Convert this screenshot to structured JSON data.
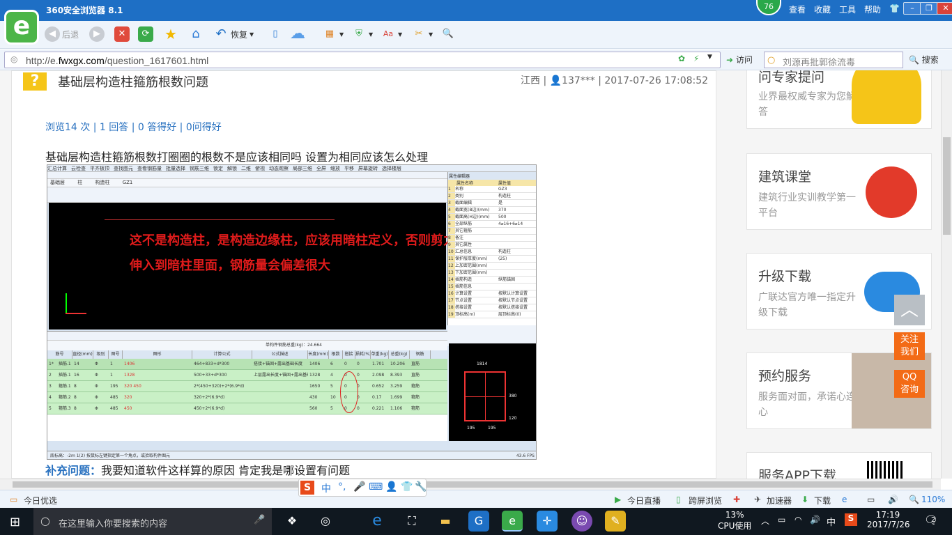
{
  "window": {
    "title": "360安全浏览器 8.1",
    "badge": "76",
    "menu": [
      "查看",
      "收藏",
      "工具",
      "帮助"
    ]
  },
  "toolbar": {
    "back": "后退",
    "restore": "恢复"
  },
  "address": {
    "url_prefix": "http://e.",
    "url_domain": "fwxgx.com",
    "url_path": "/question_1617601.html",
    "visit": "访问",
    "search_placeholder": "刘源再批郭徐流毒",
    "search_btn": "搜索"
  },
  "question": {
    "title": "基础层构造柱箍筋根数问题",
    "meta": "江西 | 👤137*** | 2017-07-26 17:08:52",
    "stats": "浏览14 次 | 1 回答 | 0 答得好 | 0问得好",
    "desc": "基础层构造柱箍筋根数打圈圈的根数不是应该相同吗  设置为相同应该怎么处理",
    "supp_label": "补充问题：",
    "supp_text": "我要知道软件这样算的原因 肯定我是哪设置有问题"
  },
  "annotation": {
    "line1": "这不是构造柱，是构造边缘柱，应该用暗柱定义，否则剪力墙水平钢筋不能",
    "line2": "伸入到暗柱里面，钢筋量会偏差很大"
  },
  "software": {
    "menu": [
      "汇总计算",
      "云检查",
      "平齐板顶",
      "查找图元",
      "查看钢筋量",
      "批量选择",
      "钢筋三维",
      "锁定",
      "解锁",
      "二维",
      "俯视",
      "动态观察",
      "局部三维",
      "全屏",
      "缩放",
      "平移",
      "屏幕旋转",
      "选择楼层"
    ],
    "layer_sel": "基础层",
    "type_sel": "柱",
    "sub_sel": "构造柱",
    "id_sel": "GZ1",
    "prop_title": "属性编辑器",
    "prop_head": [
      "属性名称",
      "属性值"
    ],
    "props": [
      [
        "1",
        "名称",
        "GZ3"
      ],
      [
        "2",
        "类别",
        "构造柱"
      ],
      [
        "3",
        "截面编辑",
        "是"
      ],
      [
        "4",
        "截面宽(B边)(mm)",
        "370"
      ],
      [
        "5",
        "截面高(H边)(mm)",
        "500"
      ],
      [
        "6",
        "全部纵筋",
        "4⌀16+6⌀14"
      ],
      [
        "7",
        "其它箍筋",
        ""
      ],
      [
        "8",
        "备注",
        ""
      ],
      [
        "9",
        "其它属性",
        ""
      ],
      [
        "10",
        "汇总信息",
        "构造柱"
      ],
      [
        "11",
        "保护层厚度(mm)",
        "(25)"
      ],
      [
        "12",
        "上加密范围(mm)",
        ""
      ],
      [
        "13",
        "下加密范围(mm)",
        ""
      ],
      [
        "14",
        "插筋构造",
        "纵筋锚固"
      ],
      [
        "15",
        "插筋信息",
        ""
      ],
      [
        "16",
        "计算设置",
        "按默认计算设置"
      ],
      [
        "17",
        "节点设置",
        "按默认节点设置"
      ],
      [
        "18",
        "搭接设置",
        "按默认搭接设置"
      ],
      [
        "19",
        "顶标高(m)",
        "层顶标高(0)"
      ]
    ],
    "table_head": [
      "筋号",
      "直径(mm)",
      "级别",
      "图号",
      "图形",
      "计算公式",
      "公式描述",
      "长度(mm)",
      "根数",
      "搭接",
      "损耗(%)",
      "单重(kg)",
      "总重(kg)",
      "钢筋"
    ],
    "rows": [
      [
        "1*",
        "插筋.1",
        "14",
        "Φ",
        "1",
        "1406",
        "464+833+d*300",
        "搭接+锚固+露出基础长度",
        "1406",
        "6",
        "0",
        "0",
        "1.701",
        "10.206",
        "直筋"
      ],
      [
        "2",
        "插筋.1",
        "16",
        "Φ",
        "1",
        "1328",
        "500+33+d*300",
        "上层露出长度+锚固+露出基础长度",
        "1328",
        "4",
        "0",
        "0",
        "2.098",
        "8.393",
        "直筋"
      ],
      [
        "3",
        "箍筋.1",
        "8",
        "Φ",
        "195",
        "320 450",
        "2*(450+320)+2*(6.9*d)",
        "",
        "1650",
        "5",
        "0",
        "0",
        "0.652",
        "3.259",
        "箍筋"
      ],
      [
        "4",
        "箍筋.2",
        "8",
        "Φ",
        "485",
        "320",
        "320+2*(6.9*d)",
        "",
        "430",
        "10",
        "0",
        "0",
        "0.17",
        "1.699",
        "箍筋"
      ],
      [
        "5",
        "箍筋.3",
        "8",
        "Φ",
        "485",
        "450",
        "450+2*(6.9*d)",
        "",
        "560",
        "5",
        "0",
        "0",
        "0.221",
        "1.106",
        "箍筋"
      ]
    ],
    "total": "单构件钢筋总重(kg)：24.664",
    "status": "底标高：-2m   1(2)   按鼠标左键指定第一个角点，或拾取构件图元",
    "fps": "43.6 FPS",
    "section_labels": [
      "1814",
      "380",
      "120",
      "195",
      "195"
    ]
  },
  "sidebar": [
    {
      "h": "问专家提问",
      "s": "业界最权威专家为您解答"
    },
    {
      "h": "建筑课堂",
      "s": "建筑行业实训教学第一平台"
    },
    {
      "h": "升级下载",
      "s": "广联达官方唯一指定升级下载"
    },
    {
      "h": "预约服务",
      "s": "服务面对面，承诺心连心"
    },
    {
      "h": "服务APP下载",
      "s": ""
    }
  ],
  "float": {
    "contact": "关注我们",
    "qq": "QQ咨询"
  },
  "status": {
    "left": "今日优选",
    "live": "今日直播",
    "cross": "跨屏浏览",
    "accel": "加速器",
    "download": "下载",
    "zoom": "110%"
  },
  "ime": {
    "lang": "中"
  },
  "taskbar": {
    "search": "在这里输入你要搜索的内容",
    "cpu_pct": "13%",
    "cpu": "CPU使用",
    "lang": "中",
    "time": "17:19",
    "date": "2017/7/26",
    "notif": "2"
  }
}
